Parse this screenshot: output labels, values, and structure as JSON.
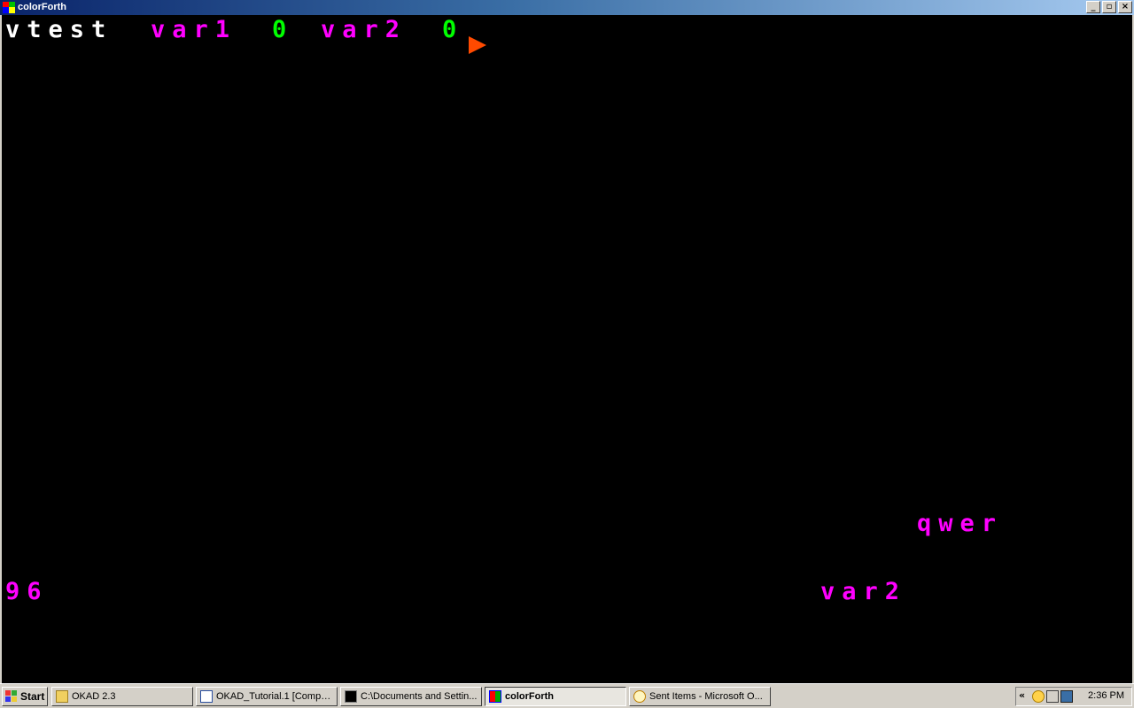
{
  "window": {
    "title": "colorForth",
    "caption_buttons": {
      "minimize": "_",
      "maximize": "▫",
      "close": "×"
    }
  },
  "editor": {
    "line1": [
      {
        "text": "vtest",
        "color": "#ffffff"
      },
      {
        "text": "var1",
        "color": "#ff00ff"
      },
      {
        "text": "0",
        "color": "#00ff00"
      },
      {
        "text": "var2",
        "color": "#ff00ff"
      },
      {
        "text": "0",
        "color": "#00ff00"
      }
    ],
    "cursor_color": "#ff4a00",
    "status": {
      "stack_value": "96",
      "word_qwer": "qwer",
      "word_var2": "var2"
    }
  },
  "taskbar": {
    "start_label": "Start",
    "tasks": [
      {
        "label": "OKAD 2.3",
        "icon": "folder-icon"
      },
      {
        "label": "OKAD_Tutorial.1 [Compa...",
        "icon": "word-document-icon"
      },
      {
        "label": "C:\\Documents and Settin...",
        "icon": "command-prompt-icon"
      },
      {
        "label": "colorForth",
        "icon": "colorforth-icon",
        "active": true
      },
      {
        "label": "Sent Items - Microsoft O...",
        "icon": "outlook-icon"
      }
    ],
    "tray": {
      "expand": "«",
      "clock": "2:36 PM"
    }
  }
}
